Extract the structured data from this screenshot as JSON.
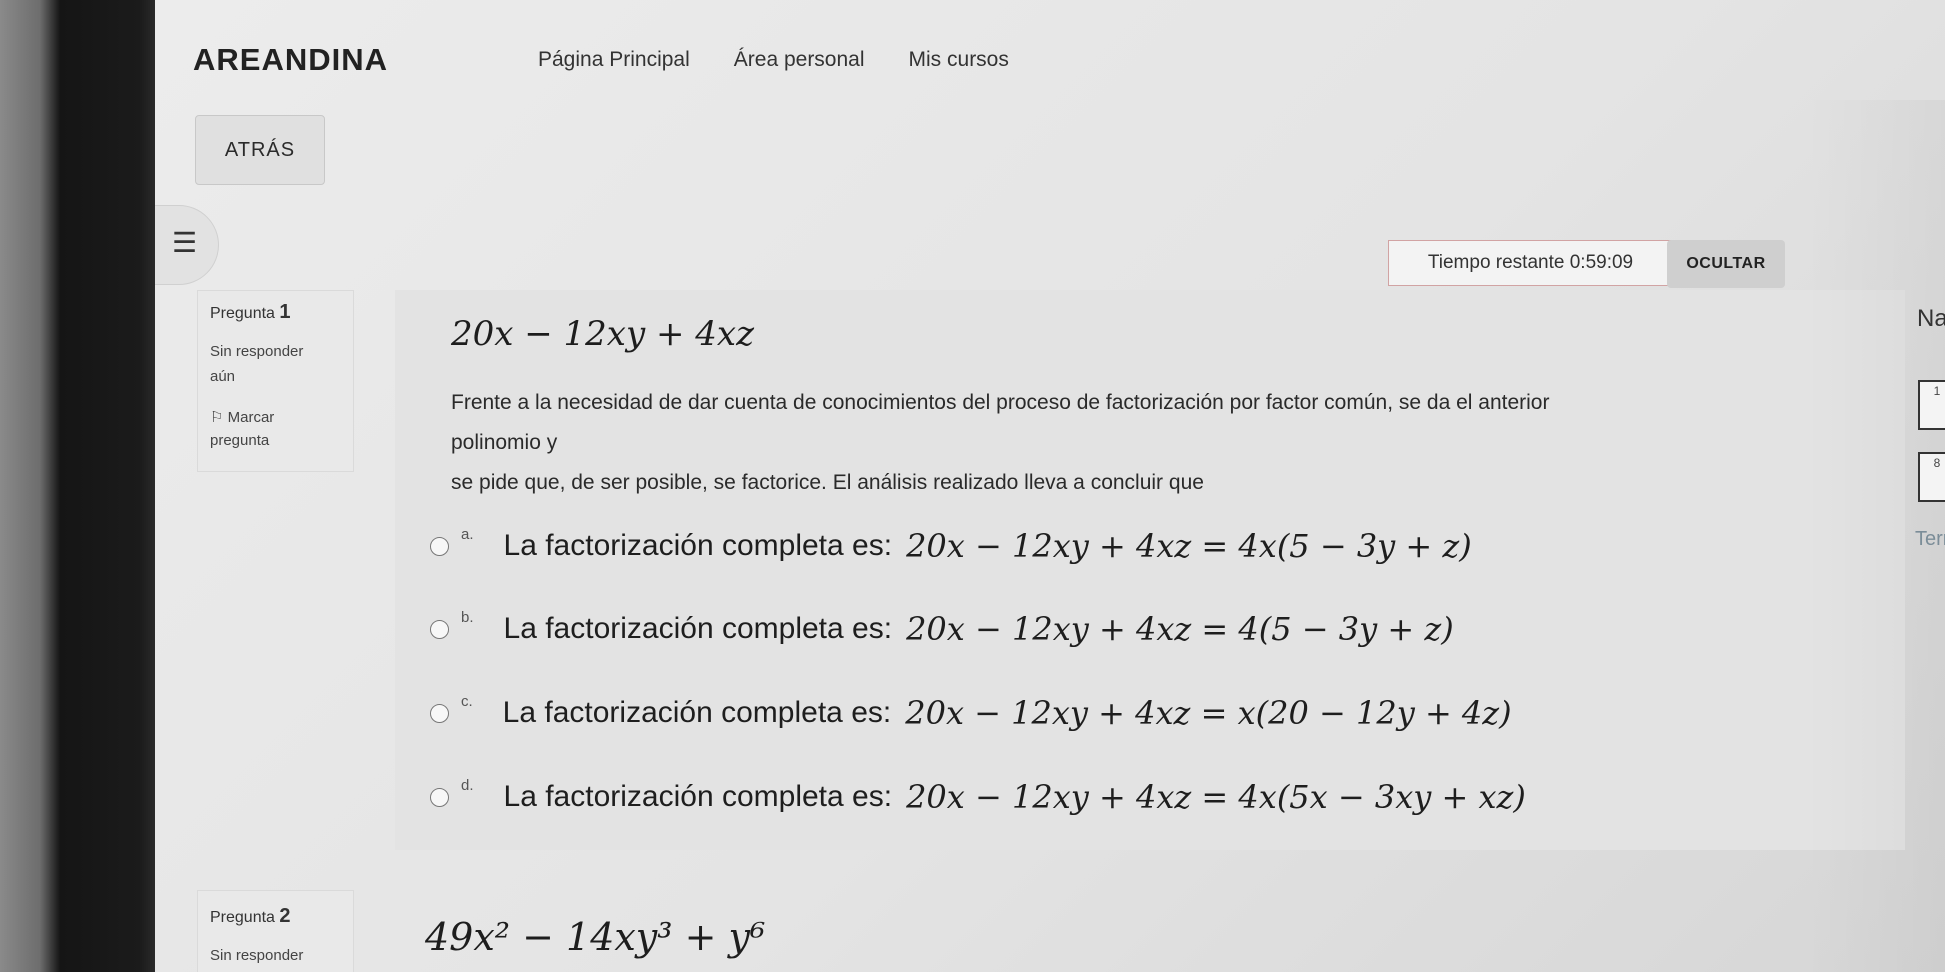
{
  "brand": "AREANDINA",
  "nav": [
    "Página Principal",
    "Área personal",
    "Mis cursos"
  ],
  "back_button": "ATRÁS",
  "drawer_icon": "list-icon",
  "timer": {
    "label": "Tiempo restante",
    "value": "0:59:09",
    "hide_button": "OCULTAR"
  },
  "question1": {
    "label": "Pregunta",
    "number": "1",
    "status_line1": "Sin responder",
    "status_line2": "aún",
    "flag_line1": "Marcar",
    "flag_line2": "pregunta",
    "expression": "20x − 12xy + 4xz",
    "text_line1": "Frente a la necesidad de dar cuenta de conocimientos del proceso de factorización por factor común, se da el anterior polinomio y",
    "text_line2": "se pide que, de ser posible, se factorice. El análisis realizado lleva a concluir que",
    "options": [
      {
        "letter": "a.",
        "text": "La factorización completa es:",
        "math": "20x − 12xy + 4xz = 4x(5 − 3y + z)"
      },
      {
        "letter": "b.",
        "text": "La factorización completa es:",
        "math": "20x − 12xy + 4xz = 4(5 − 3y + z)"
      },
      {
        "letter": "c.",
        "text": "La factorización completa es:",
        "math": "20x − 12xy + 4xz = x(20 − 12y + 4z)"
      },
      {
        "letter": "d.",
        "text": "La factorización completa es:",
        "math": "20x − 12xy + 4xz = 4x(5x − 3xy + xz)"
      }
    ]
  },
  "navigation": {
    "title": "Nave",
    "blocks": [
      "1",
      "8"
    ],
    "finish": "Termir"
  },
  "question2": {
    "label": "Pregunta",
    "number": "2",
    "status_line1": "Sin responder",
    "expression": "49x² − 14xy³ + y⁶"
  }
}
